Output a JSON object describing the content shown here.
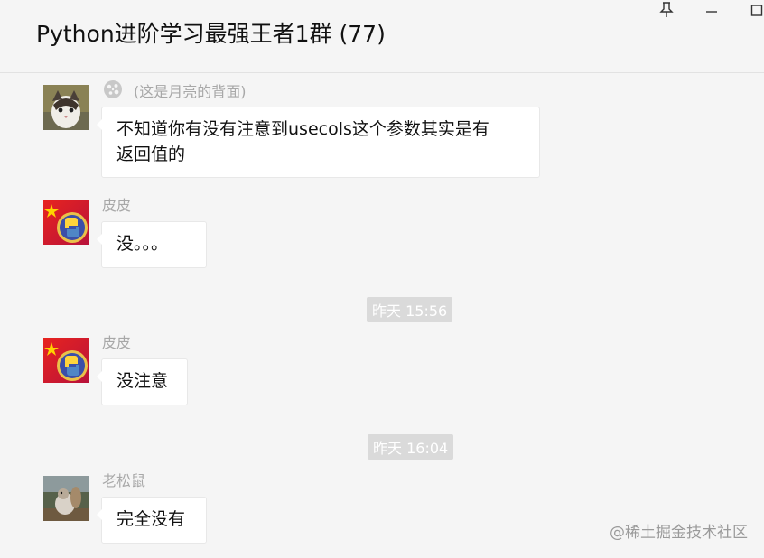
{
  "header": {
    "title": "Python进阶学习最强王者1群 (77)",
    "pin_icon": "pin-icon",
    "minimize_icon": "minimize-icon",
    "maximize_icon": "maximize-icon"
  },
  "messages": [
    {
      "sender": "(这是月亮的背面)",
      "text_line1": "不知道你有没有注意到usecols这个参数其实是有",
      "text_line2": "返回值的"
    },
    {
      "sender": "皮皮",
      "text": "没。。。"
    },
    {
      "time": "昨天 15:56"
    },
    {
      "sender": "皮皮",
      "text": "没注意"
    },
    {
      "time": "昨天 16:04"
    },
    {
      "sender": "老松鼠",
      "text": "完全没有"
    }
  ],
  "watermark": "@稀土掘金技术社区",
  "colors": {
    "background": "#f5f5f5",
    "bubble": "#ffffff",
    "time_badge": "#dadada",
    "sender": "#a8a8a8"
  }
}
